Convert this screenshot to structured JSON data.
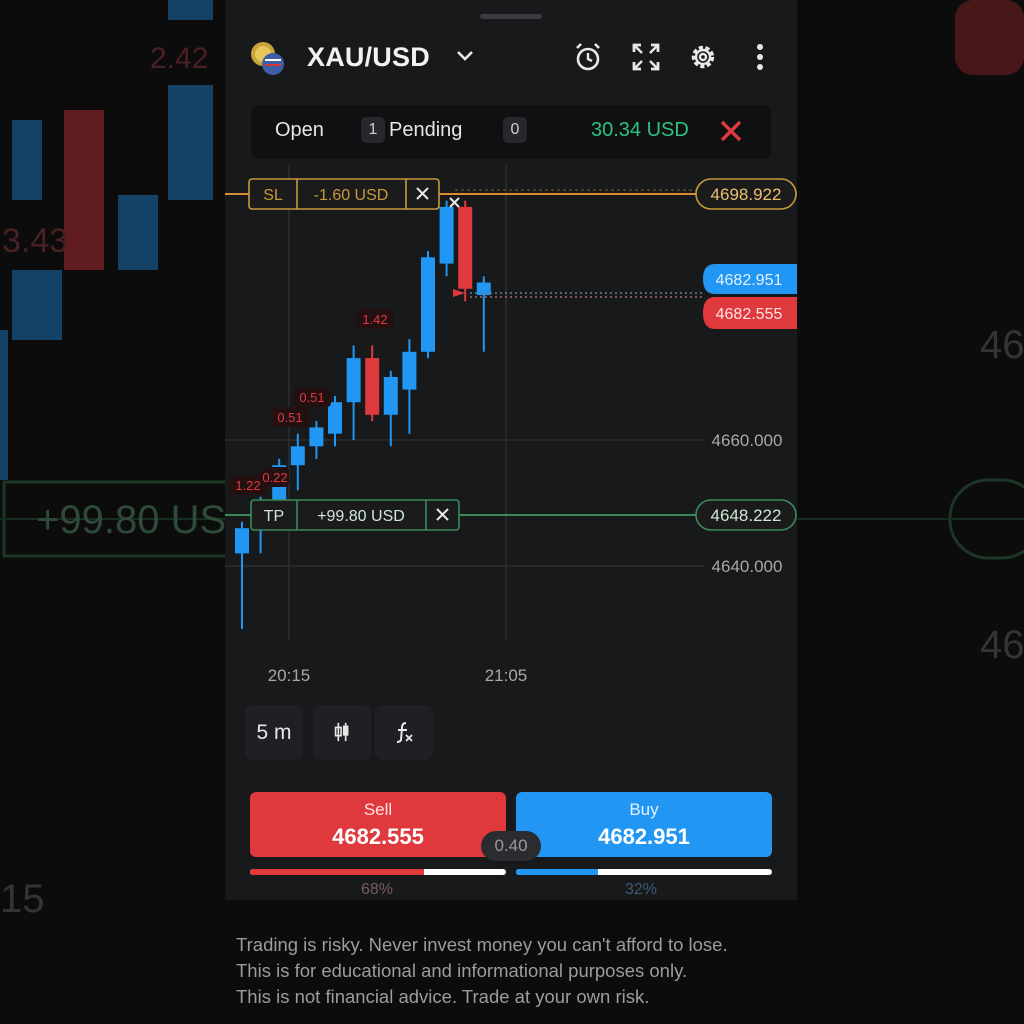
{
  "header": {
    "symbol": "XAU/USD",
    "icons": [
      "alarm-clock-icon",
      "fullscreen-icon",
      "gear-icon",
      "more-vertical-icon"
    ]
  },
  "positions": {
    "open_label": "Open",
    "open_count": "1",
    "pending_label": "Pending",
    "pending_count": "0",
    "profit": "30.34 USD",
    "profit_color": "#2ec27e"
  },
  "chart": {
    "sl_tag": "SL",
    "sl_value": "-1.60 USD",
    "sl_price": "4698.922",
    "tp_tag": "TP",
    "tp_value": "+99.80 USD",
    "tp_price": "4648.222",
    "buy_price_tag": "4682.951",
    "sell_price_tag": "4682.555",
    "price_ticks": [
      "4660.000",
      "4640.000"
    ],
    "time_ticks": [
      "20:15",
      "21:05"
    ],
    "trade_labels": [
      "1.42",
      "0.51",
      "0.51",
      "1.22",
      "0.22"
    ],
    "candles": [
      {
        "o": 4642,
        "h": 4647,
        "l": 4630,
        "c": 4646
      },
      {
        "o": 4646,
        "h": 4651,
        "l": 4642,
        "c": 4650
      },
      {
        "o": 4650,
        "h": 4657,
        "l": 4646,
        "c": 4656
      },
      {
        "o": 4656,
        "h": 4661,
        "l": 4652,
        "c": 4659
      },
      {
        "o": 4659,
        "h": 4663,
        "l": 4657,
        "c": 4662
      },
      {
        "o": 4661,
        "h": 4667,
        "l": 4659,
        "c": 4666
      },
      {
        "o": 4666,
        "h": 4675,
        "l": 4660,
        "c": 4673
      },
      {
        "o": 4673,
        "h": 4675,
        "l": 4663,
        "c": 4664
      },
      {
        "o": 4664,
        "h": 4671,
        "l": 4659,
        "c": 4670
      },
      {
        "o": 4668,
        "h": 4676,
        "l": 4661,
        "c": 4674
      },
      {
        "o": 4674,
        "h": 4690,
        "l": 4673,
        "c": 4689
      },
      {
        "o": 4688,
        "h": 4698,
        "l": 4686,
        "c": 4697
      },
      {
        "o": 4697,
        "h": 4698,
        "l": 4682,
        "c": 4684
      },
      {
        "o": 4683,
        "h": 4686,
        "l": 4674,
        "c": 4685
      }
    ],
    "up_color": "#2196f3",
    "down_color": "#e0393d"
  },
  "timeframe": {
    "interval": "5 m",
    "icons": [
      "candlestick-type-icon",
      "indicators-icon"
    ]
  },
  "trade": {
    "sell_label": "Sell",
    "sell_price": "4682.555",
    "buy_label": "Buy",
    "buy_price": "4682.951",
    "spread": "0.40",
    "sell_sentiment_pct": "68%",
    "buy_sentiment_pct": "32%",
    "sell_sentiment": 0.68,
    "buy_sentiment": 0.32
  },
  "disclaimer": {
    "line1": "Trading is risky. Never invest money you can't afford to lose.",
    "line2": "This is for educational and informational purposes only.",
    "line3": "This is not financial advice. Trade at your own risk."
  },
  "background": {
    "left_pl": "+99.80 US",
    "left_label": "3.43",
    "left_top_label": "2.42",
    "right_label": "46",
    "right_label2": "46",
    "left_time": "15"
  }
}
